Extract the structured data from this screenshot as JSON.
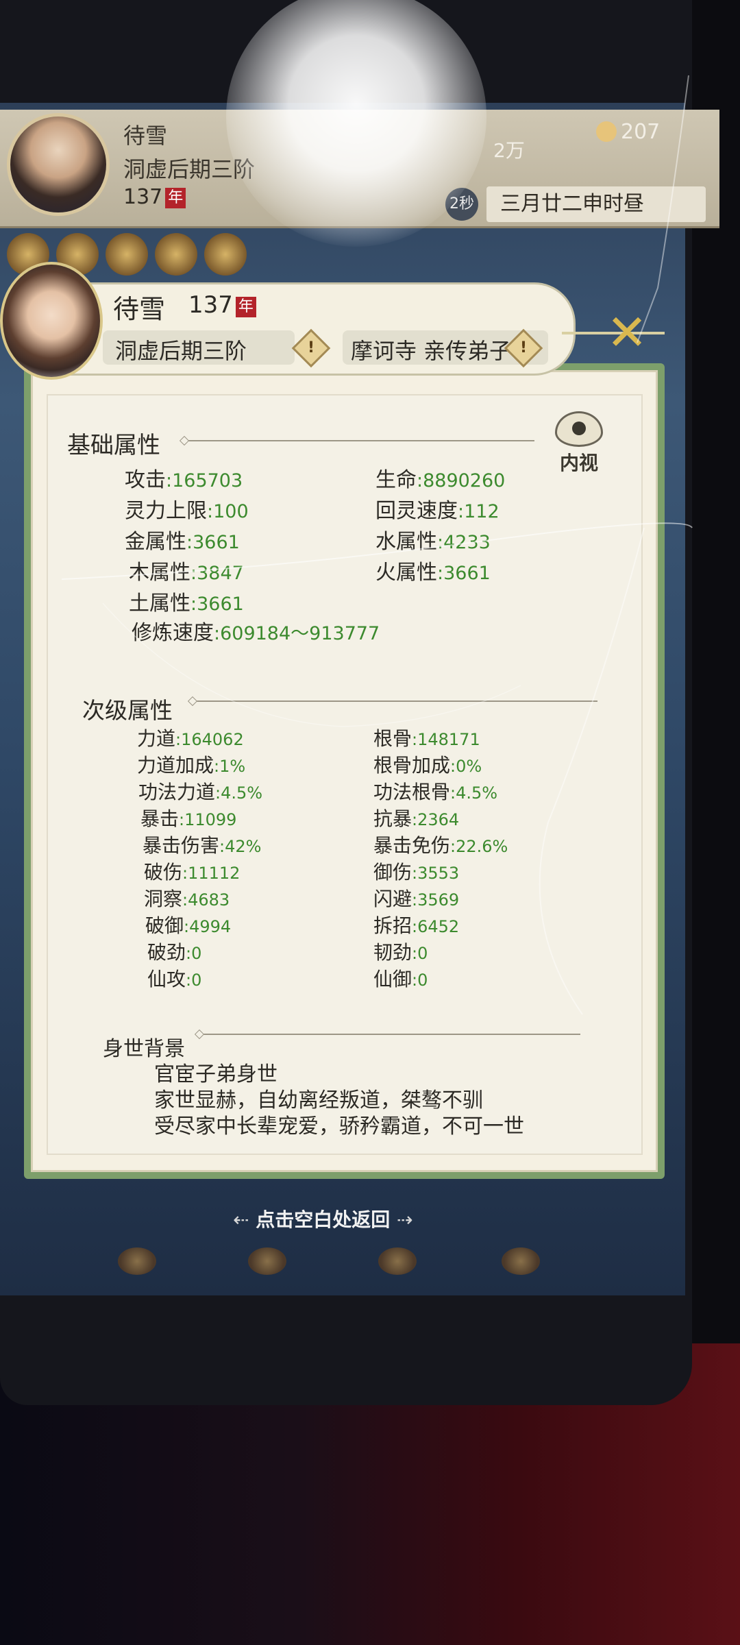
{
  "top_bar": {
    "name": "待雪",
    "realm": "洞虚后期三阶",
    "age": "137",
    "age_unit": "年",
    "currency": "2万",
    "stamina": "207",
    "timer": "2秒",
    "date": "三月廿二申时昼"
  },
  "dialog": {
    "name": "待雪",
    "age": "137",
    "age_unit": "年",
    "realm": "洞虚后期三阶",
    "sect": "摩诃寺 亲传弟子",
    "warn_mark": "!",
    "close_glyph": "✕",
    "view_body_label": "内视"
  },
  "basic": {
    "title": "基础属性",
    "stats": [
      {
        "label": "攻击",
        "value": ":165703"
      },
      {
        "label": "生命",
        "value": ":8890260"
      },
      {
        "label": "灵力上限",
        "value": ":100"
      },
      {
        "label": "回灵速度",
        "value": ":112"
      },
      {
        "label": "金属性",
        "value": ":3661"
      },
      {
        "label": "水属性",
        "value": ":4233"
      },
      {
        "label": "木属性",
        "value": ":3847"
      },
      {
        "label": "火属性",
        "value": ":3661"
      },
      {
        "label": "土属性",
        "value": ":3661"
      },
      {
        "label": "修炼速度",
        "value": ":609184～913777"
      }
    ]
  },
  "secondary": {
    "title": "次级属性",
    "stats": [
      {
        "label": "力道",
        "value": ":164062"
      },
      {
        "label": "根骨",
        "value": ":148171"
      },
      {
        "label": "力道加成",
        "value": ":1%"
      },
      {
        "label": "根骨加成",
        "value": ":0%"
      },
      {
        "label": "功法力道",
        "value": ":4.5%"
      },
      {
        "label": "功法根骨",
        "value": ":4.5%"
      },
      {
        "label": "暴击",
        "value": ":11099"
      },
      {
        "label": "抗暴",
        "value": ":2364"
      },
      {
        "label": "暴击伤害",
        "value": ":42%"
      },
      {
        "label": "暴击免伤",
        "value": ":22.6%"
      },
      {
        "label": "破伤",
        "value": ":11112"
      },
      {
        "label": "御伤",
        "value": ":3553"
      },
      {
        "label": "洞察",
        "value": ":4683"
      },
      {
        "label": "闪避",
        "value": ":3569"
      },
      {
        "label": "破御",
        "value": ":4994"
      },
      {
        "label": "拆招",
        "value": ":6452"
      },
      {
        "label": "破劲",
        "value": ":0"
      },
      {
        "label": "韧劲",
        "value": ":0"
      },
      {
        "label": "仙攻",
        "value": ":0"
      },
      {
        "label": "仙御",
        "value": ":0"
      }
    ]
  },
  "background": {
    "title": "身世背景",
    "lines": [
      "官宦子弟身世",
      "家世显赫，自幼离经叛道，桀骜不驯",
      "受尽家中长辈宠爱，骄矜霸道，不可一世"
    ]
  },
  "footer": {
    "return_hint": "点击空白处返回",
    "arrow_left": "⇠",
    "arrow_right": "⇢"
  },
  "colors": {
    "stat_value": "#3c8a2e",
    "panel_border": "#7d9f6b",
    "panel_bg": "#f5f0e2",
    "age_badge": "#b3232a"
  }
}
